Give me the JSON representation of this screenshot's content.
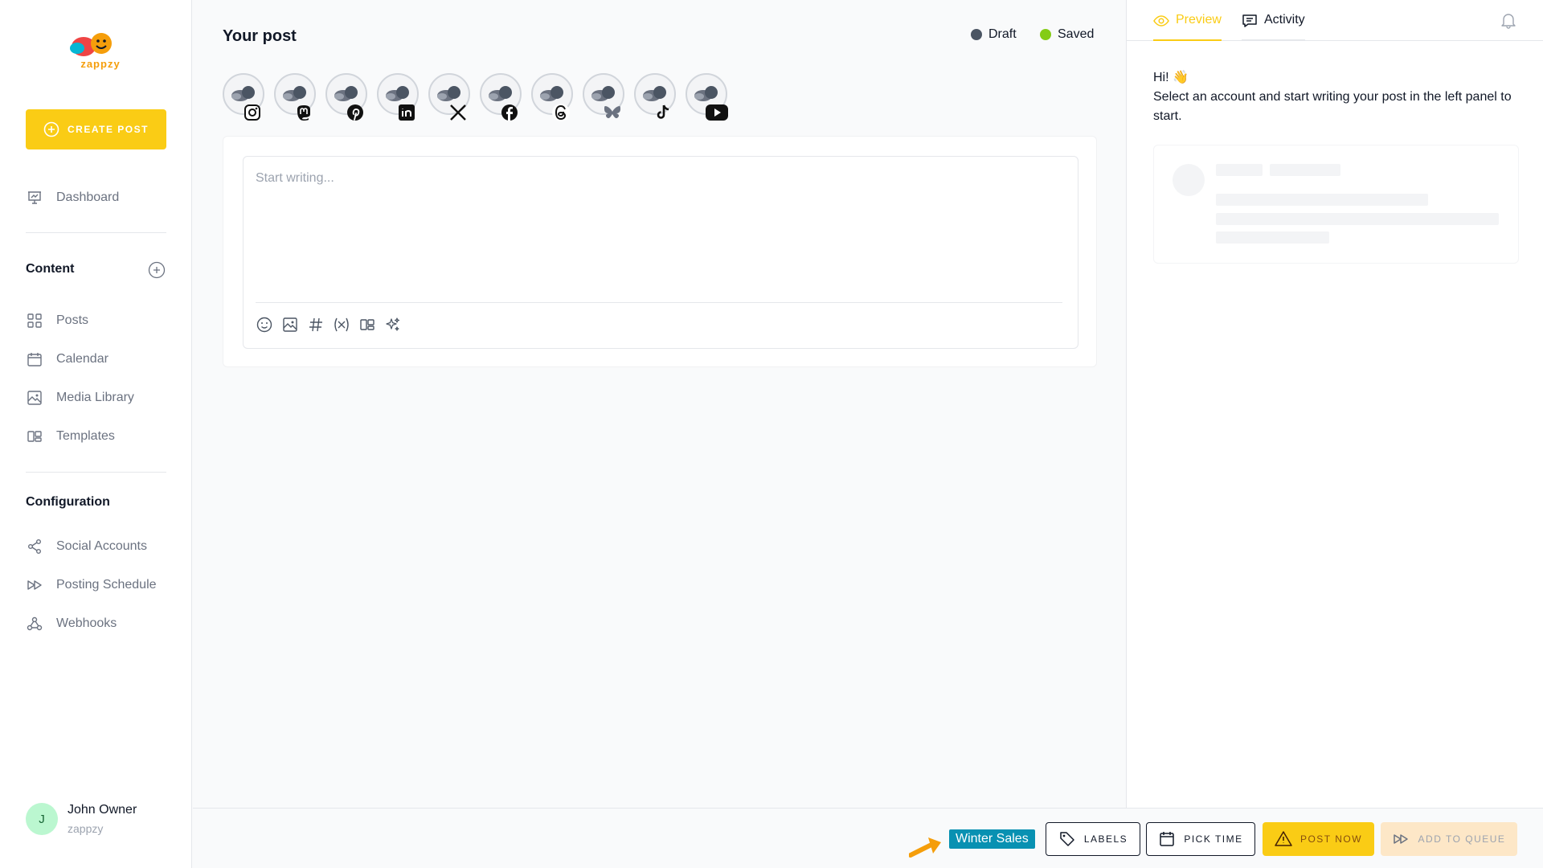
{
  "colors": {
    "accent": "#facc15",
    "draft_dot": "#4b5563",
    "saved_dot": "#84cc16",
    "label_chip": "#0891b2",
    "arrow": "#f59e0b"
  },
  "sidebar": {
    "logo_text": "zappzy",
    "create_post_label": "CREATE POST",
    "dashboard": {
      "label": "Dashboard",
      "icon": "presentation-chart-icon"
    },
    "content_section": {
      "title": "Content",
      "items": [
        {
          "label": "Posts",
          "icon": "grid-icon"
        },
        {
          "label": "Calendar",
          "icon": "calendar-icon"
        },
        {
          "label": "Media Library",
          "icon": "image-icon"
        },
        {
          "label": "Templates",
          "icon": "templates-icon"
        }
      ]
    },
    "configuration_section": {
      "title": "Configuration",
      "items": [
        {
          "label": "Social Accounts",
          "icon": "share-icon"
        },
        {
          "label": "Posting Schedule",
          "icon": "fast-forward-icon"
        },
        {
          "label": "Webhooks",
          "icon": "webhook-icon"
        }
      ]
    },
    "user": {
      "initial": "J",
      "name": "John Owner",
      "org": "zappzy"
    }
  },
  "main": {
    "title": "Your post",
    "status": {
      "draft": "Draft",
      "saved": "Saved"
    },
    "accounts": [
      {
        "network": "instagram"
      },
      {
        "network": "mastodon"
      },
      {
        "network": "pinterest"
      },
      {
        "network": "linkedin"
      },
      {
        "network": "x"
      },
      {
        "network": "facebook"
      },
      {
        "network": "threads"
      },
      {
        "network": "bluesky"
      },
      {
        "network": "tiktok"
      },
      {
        "network": "youtube"
      }
    ],
    "editor": {
      "placeholder": "Start writing...",
      "value": "",
      "toolbar": [
        "emoji-icon",
        "image-icon",
        "hashtag-icon",
        "variable-icon",
        "templates-icon",
        "ai-sparkles-icon"
      ]
    }
  },
  "right_panel": {
    "tabs": {
      "preview": "Preview",
      "activity": "Activity"
    },
    "intro_line1": "Hi! 👋",
    "intro_line2": "Select an account and start writing your post in the left panel to start."
  },
  "bottom_bar": {
    "label_chip": "Winter Sales",
    "labels_button": "LABELS",
    "pick_time_button": "PICK TIME",
    "post_now_button": "POST NOW",
    "add_to_queue_button": "ADD TO QUEUE"
  }
}
